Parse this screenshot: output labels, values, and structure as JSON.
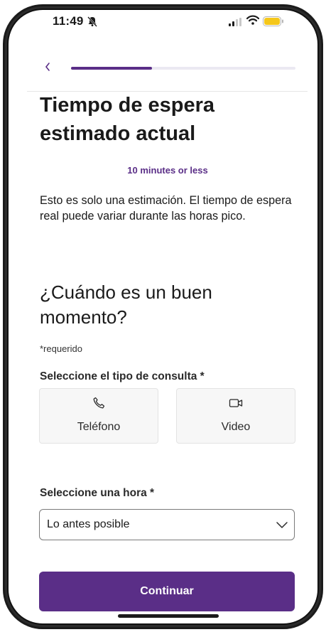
{
  "status": {
    "time": "11:49"
  },
  "progress": {
    "fraction": 0.36
  },
  "colors": {
    "accent": "#5a2e87",
    "track": "#ebe9f2"
  },
  "page": {
    "title": "Tiempo de espera estimado actual",
    "wait_time": "10 minutes or less",
    "note": "Esto es solo una estimación. El tiempo de espera real puede variar durante las horas pico."
  },
  "form": {
    "section_title": "¿Cuándo es un buen momento?",
    "required_note": "*requerido",
    "consult_label": "Seleccione el tipo de consulta *",
    "options": [
      {
        "label": "Teléfono",
        "icon": "phone-icon"
      },
      {
        "label": "Video",
        "icon": "video-camera-icon"
      }
    ],
    "time_label": "Seleccione una hora *",
    "time_value": "Lo antes posible"
  },
  "actions": {
    "continue_label": "Continuar"
  }
}
